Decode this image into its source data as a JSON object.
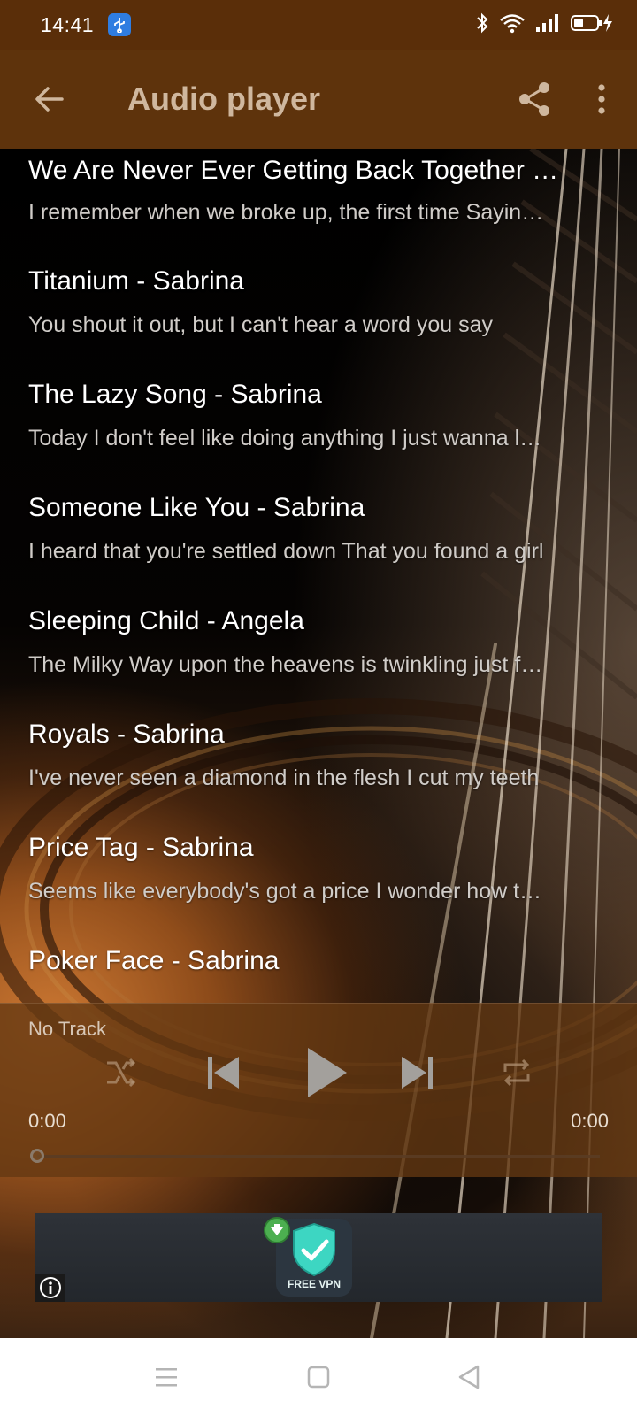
{
  "status_bar": {
    "time": "14:41",
    "icons": [
      "usb-icon",
      "bluetooth-icon",
      "wifi-icon",
      "signal-icon",
      "battery-charging-icon"
    ]
  },
  "app_bar": {
    "title": "Audio player",
    "back_icon": "arrow-left-icon",
    "share_icon": "share-icon",
    "more_icon": "more-vertical-icon",
    "background_color": "#5e330c",
    "title_color": "#cfb79e"
  },
  "songs": [
    {
      "title": "We Are Never Ever Getting Back Together - Sabrina",
      "lyric": "I remember when we broke up, the first time Saying this is it"
    },
    {
      "title": "Titanium - Sabrina",
      "lyric": "You shout it out, but I can't hear a word you say"
    },
    {
      "title": "The Lazy Song - Sabrina",
      "lyric": "Today I don't feel like doing anything I just wanna lay in my bed"
    },
    {
      "title": "Someone Like You - Sabrina",
      "lyric": "I heard that you're settled down That you found a girl"
    },
    {
      "title": "Sleeping Child - Angela",
      "lyric": "The Milky Way upon the heavens is twinkling just for you"
    },
    {
      "title": "Royals - Sabrina",
      "lyric": "I've never seen a diamond in the flesh I cut my teeth"
    },
    {
      "title": "Price Tag - Sabrina",
      "lyric": "Seems like everybody's got a price I wonder how they sleep"
    },
    {
      "title": "Poker Face - Sabrina",
      "lyric": ""
    }
  ],
  "player": {
    "track": "No Track",
    "elapsed": "0:00",
    "duration": "0:00",
    "progress": 0,
    "controls": [
      "shuffle-icon",
      "skip-previous-icon",
      "play-icon",
      "skip-next-icon",
      "repeat-icon"
    ]
  },
  "ad": {
    "text": "FREE VPN",
    "info_icon": "info-icon"
  },
  "nav": {
    "icons": [
      "menu-icon",
      "home-square-icon",
      "back-triangle-icon"
    ]
  }
}
